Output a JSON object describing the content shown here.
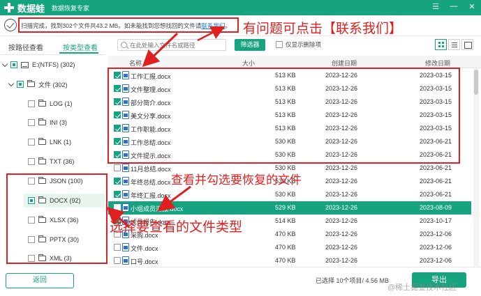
{
  "titlebar": {
    "app_name": "数据蛙",
    "subtitle": "数据恢复专家",
    "controls": [
      "☰",
      "—",
      "✕"
    ]
  },
  "status": {
    "text": "扫描完成，找到302个文件共43.2 MB。如未能找到您想找回的文件请",
    "link": "联系我们",
    "suffix": "。"
  },
  "tabs": {
    "by_path": "按路径查看",
    "by_type": "按类型查看"
  },
  "search": {
    "placeholder": "在此处输入文件名或路径"
  },
  "toolbar": {
    "filter": "筛选器",
    "only_deleted": "仅显示删除项"
  },
  "table": {
    "headers": {
      "name": "名称",
      "size": "大小",
      "created": "创建日期",
      "modified": "修改日期"
    },
    "rows": [
      {
        "name": "工作汇报.docx",
        "size": "513 KB",
        "created": "2023-12-26",
        "modified": "2023-03-15",
        "checked": true
      },
      {
        "name": "文件整理.docx",
        "size": "513 KB",
        "created": "2023-12-26",
        "modified": "2023-03-15",
        "checked": true
      },
      {
        "name": "部分简介.docx",
        "size": "513 KB",
        "created": "2023-12-26",
        "modified": "2023-03-15",
        "checked": true
      },
      {
        "name": "美文分享.docx",
        "size": "513 KB",
        "created": "2023-12-26",
        "modified": "2023-03-15",
        "checked": true
      },
      {
        "name": "工作职能.docx",
        "size": "513 KB",
        "created": "2023-12-26",
        "modified": "2023-03-15",
        "checked": true
      },
      {
        "name": "工作总结.docx",
        "size": "530 KB",
        "created": "2023-12-26",
        "modified": "2023-06-21",
        "checked": true
      },
      {
        "name": "文件提示.docx",
        "size": "530 KB",
        "created": "2023-12-26",
        "modified": "2023-06-21",
        "checked": true
      },
      {
        "name": "11月总结.docx",
        "size": "530 KB",
        "created": "2023-12-26",
        "modified": "2023-06-21",
        "checked": false
      },
      {
        "name": "年终总结.docx",
        "size": "530 KB",
        "created": "2023-12-26",
        "modified": "2023-06-21",
        "checked": true
      },
      {
        "name": "年终汇报.docx",
        "size": "530 KB",
        "created": "2023-12-26",
        "modified": "2023-06-21",
        "checked": true
      },
      {
        "name": "小组成员汇报.docx",
        "size": "529 KB",
        "created": "2023-12-26",
        "modified": "2023-08-09",
        "checked": false
      },
      {
        "name": "成员报告.docx",
        "size": "514 KB",
        "created": "2023-12-26",
        "modified": "2023-10-17",
        "checked": true
      },
      {
        "name": "采购.docx",
        "size": "470 KB",
        "created": "2023-12-26",
        "modified": "2023-12-06",
        "checked": false
      },
      {
        "name": "文件.docx",
        "size": "470 KB",
        "created": "2023-12-26",
        "modified": "2023-12-06",
        "checked": false
      },
      {
        "name": "口号.docx",
        "size": "470 KB",
        "created": "2023-12-26",
        "modified": "2023-12-06",
        "checked": false
      }
    ]
  },
  "tree": {
    "drive": "E:(NTFS) (302)",
    "folder": "文件 (302)",
    "types": [
      "LOG (1)",
      "INI (3)",
      "LNK (1)",
      "TXT (36)",
      "JSON (100)",
      "DOCX (92)",
      "XLSX (36)",
      "PPTX (30)",
      "XML (3)"
    ]
  },
  "footer": {
    "back": "返回",
    "selected": "已选择 10个项目/ 4.56 MB",
    "export": "导出",
    "watermark": "@稀土掘金技术社区"
  },
  "annotations": {
    "contact": "有问题可点击【联系我们】",
    "select_files": "查看并勾选要恢复的文件",
    "select_type": "选择要查看的文件类型"
  },
  "colors": {
    "brand": "#16a37f",
    "annotation": "#e02020"
  }
}
